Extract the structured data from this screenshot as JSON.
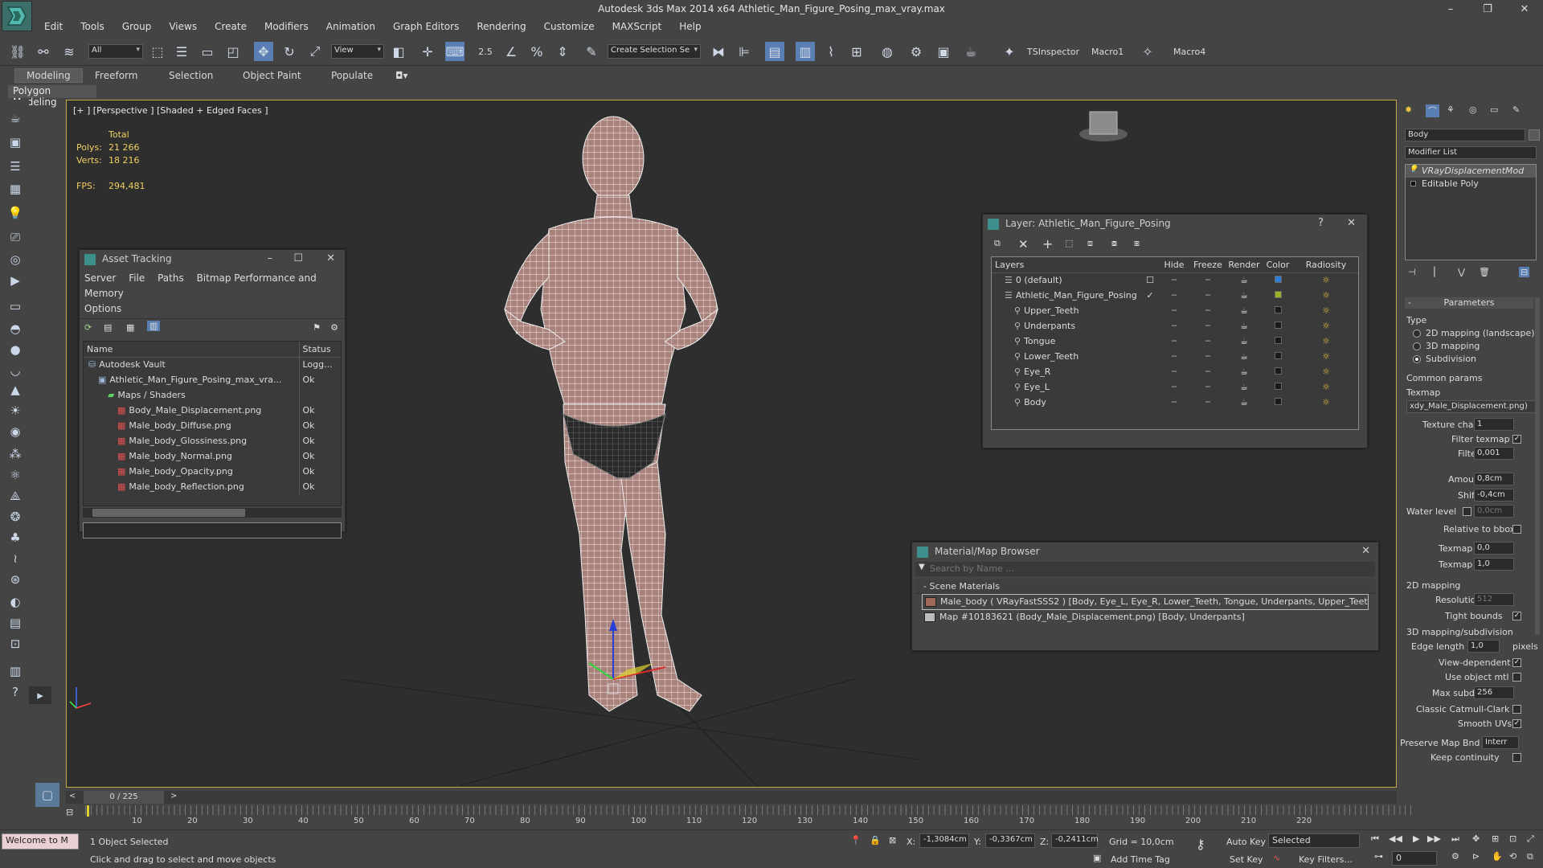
{
  "window": {
    "title": "Autodesk 3ds Max  2014 x64     Athletic_Man_Figure_Posing_max_vray.max",
    "minimize": "–",
    "maximize": "❐",
    "close": "✕"
  },
  "menu": [
    "Edit",
    "Tools",
    "Group",
    "Views",
    "Create",
    "Modifiers",
    "Animation",
    "Graph Editors",
    "Rendering",
    "Customize",
    "MAXScript",
    "Help"
  ],
  "toolbar": {
    "filter_value": "All",
    "refcoord_value": "View",
    "selection_set_placeholder": "Create Selection Se",
    "snap_label": "2.5",
    "macros": [
      "TSInspector",
      "Macro1",
      "Macro4"
    ]
  },
  "ribbon": {
    "tabs": [
      "Modeling",
      "Freeform",
      "Selection",
      "Object Paint",
      "Populate"
    ],
    "panel_label": "Polygon Modeling"
  },
  "viewport": {
    "label": "[+ ] [Perspective ] [Shaded + Edged Faces ]",
    "stats": {
      "total_label": "Total",
      "polys_label": "Polys:",
      "polys_value": "21 266",
      "verts_label": "Verts:",
      "verts_value": "18 216",
      "fps_label": "FPS:",
      "fps_value": "294,481"
    }
  },
  "asset_tracking": {
    "title": "Asset Tracking",
    "menu": [
      "Server",
      "File",
      "Paths",
      "Bitmap Performance and Memory",
      "Options"
    ],
    "columns": [
      "Name",
      "Status"
    ],
    "rows": [
      {
        "name": "Autodesk Vault",
        "status": "Logg...",
        "indent": 1
      },
      {
        "name": "Athletic_Man_Figure_Posing_max_vra...",
        "status": "Ok",
        "indent": 2
      },
      {
        "name": "Maps / Shaders",
        "status": "",
        "indent": 3
      },
      {
        "name": "Body_Male_Displacement.png",
        "status": "Ok",
        "indent": 4
      },
      {
        "name": "Male_body_Diffuse.png",
        "status": "Ok",
        "indent": 4
      },
      {
        "name": "Male_body_Glossiness.png",
        "status": "Ok",
        "indent": 4
      },
      {
        "name": "Male_body_Normal.png",
        "status": "Ok",
        "indent": 4
      },
      {
        "name": "Male_body_Opacity.png",
        "status": "Ok",
        "indent": 4
      },
      {
        "name": "Male_body_Reflection.png",
        "status": "Ok",
        "indent": 4
      }
    ]
  },
  "layer_panel": {
    "title": "Layer: Athletic_Man_Figure_Posing",
    "help": "?",
    "columns": [
      "Layers",
      "Hide",
      "Freeze",
      "Render",
      "Color",
      "Radiosity"
    ],
    "rows": [
      {
        "name": "0 (default)",
        "indent": 0,
        "color": "#2f7fd8",
        "current": "☐"
      },
      {
        "name": "Athletic_Man_Figure_Posing",
        "indent": 0,
        "color": "#9ab324",
        "current": "✓"
      },
      {
        "name": "Upper_Teeth",
        "indent": 1,
        "color": "#1a1a1a",
        "current": ""
      },
      {
        "name": "Underpants",
        "indent": 1,
        "color": "#1a1a1a",
        "current": ""
      },
      {
        "name": "Tongue",
        "indent": 1,
        "color": "#1a1a1a",
        "current": ""
      },
      {
        "name": "Lower_Teeth",
        "indent": 1,
        "color": "#1a1a1a",
        "current": ""
      },
      {
        "name": "Eye_R",
        "indent": 1,
        "color": "#1a1a1a",
        "current": ""
      },
      {
        "name": "Eye_L",
        "indent": 1,
        "color": "#1a1a1a",
        "current": ""
      },
      {
        "name": "Body",
        "indent": 1,
        "color": "#1a1a1a",
        "current": ""
      }
    ]
  },
  "material_browser": {
    "title": "Material/Map Browser",
    "search_placeholder": "Search by Name ...",
    "section": "Scene Materials",
    "items": [
      "Male_body  ( VRayFastSSS2 )  [Body, Eye_L, Eye_R, Lower_Teeth, Tongue, Underpants, Upper_Teeth]",
      "Map #10183621 (Body_Male_Displacement.png)  [Body, Underpants]"
    ]
  },
  "command_panel": {
    "object_name": "Body",
    "modifier_list": "Modifier List",
    "stack": [
      "VRayDisplacementMod",
      "Editable Poly"
    ],
    "parameters_title": "Parameters",
    "type_label": "Type",
    "type_options": [
      "2D mapping (landscape)",
      "3D mapping",
      "Subdivision"
    ],
    "common_label": "Common params",
    "texmap_label": "Texmap",
    "texmap_value": "xdy_Male_Displacement.png)",
    "texture_chan_label": "Texture chan",
    "texture_chan_value": "1",
    "filter_texmap_label": "Filter texmap",
    "filter_blur_label": "Filter blur",
    "filter_blur_value": "0,001",
    "amount_label": "Amount",
    "amount_value": "0,8cm",
    "shift_label": "Shift",
    "shift_value": "-0,4cm",
    "water_label": "Water level",
    "water_value": "0,0cm",
    "relative_label": "Relative to bbox",
    "texmap_min_label": "Texmap min",
    "texmap_min_value": "0,0",
    "texmap_max_label": "Texmap max",
    "texmap_max_value": "1,0",
    "mapping2d_label": "2D mapping",
    "resolution_label": "Resolution",
    "resolution_value": "512",
    "tight_label": "Tight bounds",
    "mapping3d_label": "3D mapping/subdivision",
    "edge_label": "Edge length",
    "edge_value": "1,0",
    "pixels_label": "pixels",
    "view_dep_label": "View-dependent",
    "use_obj_label": "Use object mtl",
    "max_subdivs_label": "Max subdivs",
    "max_subdivs_value": "256",
    "catmull_label": "Classic Catmull-Clark",
    "smooth_uv_label": "Smooth UVs",
    "preserve_label": "Preserve Map Bnd",
    "preserve_value": "Interr",
    "keep_label": "Keep continuity"
  },
  "timeline": {
    "frame_counter": "0 / 225",
    "ticks": [
      "10",
      "20",
      "30",
      "40",
      "50",
      "60",
      "70",
      "80",
      "90",
      "100",
      "110",
      "120",
      "130",
      "140",
      "150",
      "160",
      "170",
      "180",
      "190",
      "200",
      "210",
      "220"
    ]
  },
  "status": {
    "listener": "Welcome to M",
    "selected": "1 Object Selected",
    "prompt": "Click and drag to select and move objects",
    "x_label": "X:",
    "x_value": "-1,3084cm",
    "y_label": "Y:",
    "y_value": "-0,3367cm",
    "z_label": "Z:",
    "z_value": "-0,2411cm",
    "grid": "Grid = 10,0cm",
    "auto_key": "Auto Key",
    "set_key": "Set Key",
    "key_mode": "Selected",
    "key_filters": "Key Filters...",
    "add_time_tag": "Add Time Tag",
    "frame_field": "0"
  }
}
